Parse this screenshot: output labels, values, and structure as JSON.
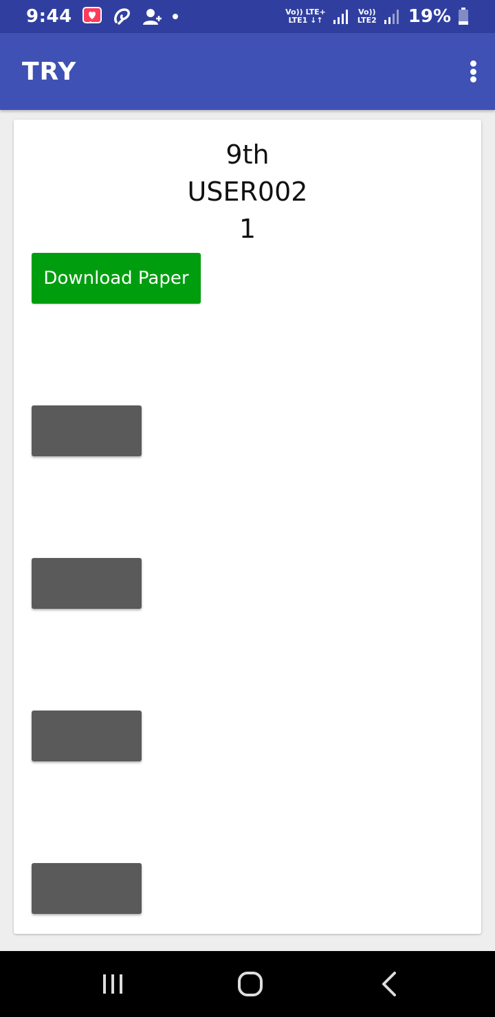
{
  "status_bar": {
    "time": "9:44",
    "net1_top": "Vo)) LTE+",
    "net1_bottom": "LTE1 ↓↑",
    "net2_top": "Vo))",
    "net2_bottom": "LTE2",
    "battery": "19%"
  },
  "app_bar": {
    "title": "TRY"
  },
  "card": {
    "lines": [
      "9th",
      "USER002",
      "1"
    ],
    "download_label": "Download Paper"
  },
  "colors": {
    "status_bar": "#303f9f",
    "app_bar": "#3f51b5",
    "download_button": "#009e0f",
    "gray_button": "#5a5a5a"
  }
}
